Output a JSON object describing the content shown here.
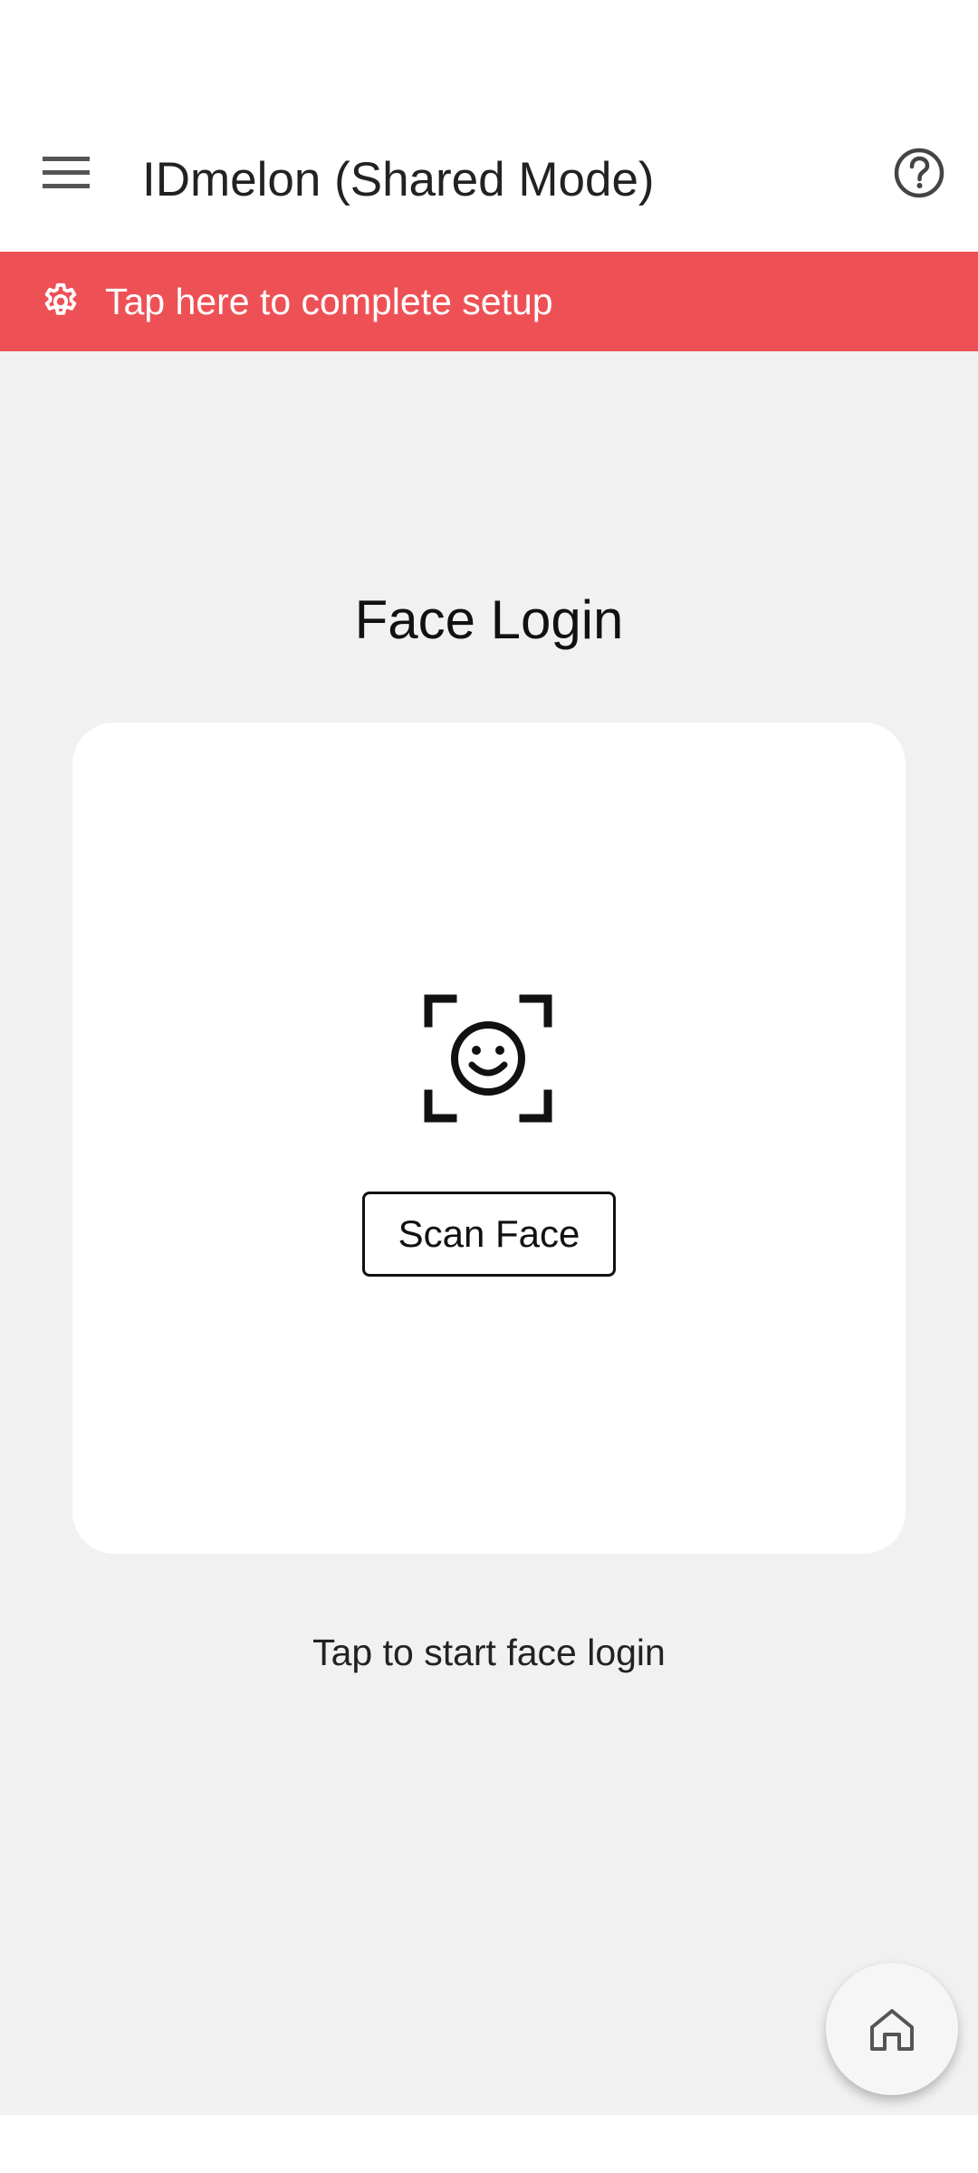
{
  "app_bar": {
    "title": "IDmelon (Shared Mode)",
    "menu_icon": "hamburger-menu-icon",
    "help_icon": "help-circle-icon"
  },
  "setup_banner": {
    "label": "Tap here to complete setup",
    "icon": "gear-icon",
    "color": "#ee5155"
  },
  "face_login": {
    "title": "Face Login",
    "icon": "face-scan-icon",
    "scan_button_label": "Scan Face",
    "hint": "Tap to start face login"
  },
  "fab": {
    "icon": "home-icon"
  }
}
